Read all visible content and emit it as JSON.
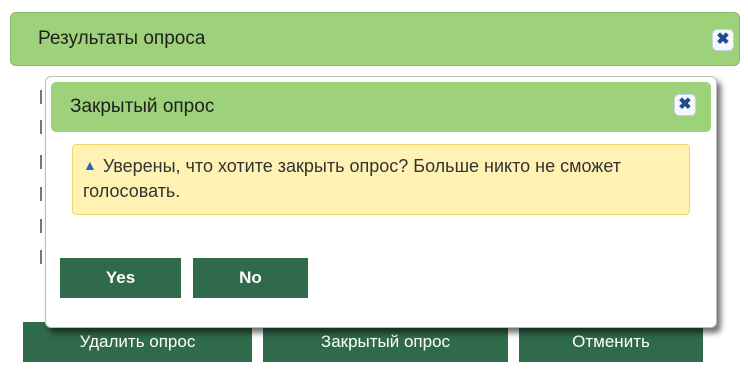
{
  "outer_dialog": {
    "title": "Результаты опроса",
    "close_glyph": "✖",
    "buttons": {
      "delete": "Удалить опрос",
      "close_poll": "Закрытый опрос",
      "cancel": "Отменить"
    }
  },
  "confirm_dialog": {
    "title": "Закрытый опрос",
    "close_glyph": "✖",
    "warning_icon": "warning-triangle-icon",
    "warning_glyph": "▲",
    "message": "Уверены, что хотите закрыть опрос? Больше никто не сможет голосовать.",
    "yes_label": "Yes",
    "no_label": "No"
  },
  "colors": {
    "header_green": "#9dd17a",
    "button_dark_green": "#2f6a4a",
    "warning_bg": "#fff2b3",
    "warning_border": "#f2d66b",
    "icon_blue": "#2563c9"
  }
}
